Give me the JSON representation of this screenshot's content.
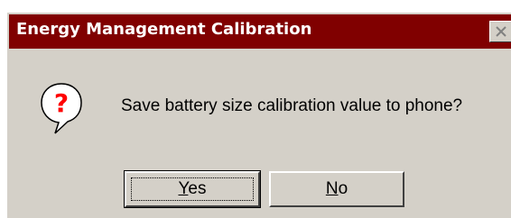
{
  "window": {
    "title": "Energy Management Calibration",
    "close_icon": "close-icon"
  },
  "message": {
    "icon": "question-icon",
    "text": "Save battery size calibration value to phone?"
  },
  "buttons": {
    "yes": {
      "mnemonic": "Y",
      "rest": "es"
    },
    "no": {
      "mnemonic": "N",
      "rest": "o"
    }
  },
  "colors": {
    "titlebar": "#800000",
    "dialog_face": "#d4d0c8",
    "icon_bubble": "#ffffff",
    "icon_mark": "#ff0000"
  }
}
